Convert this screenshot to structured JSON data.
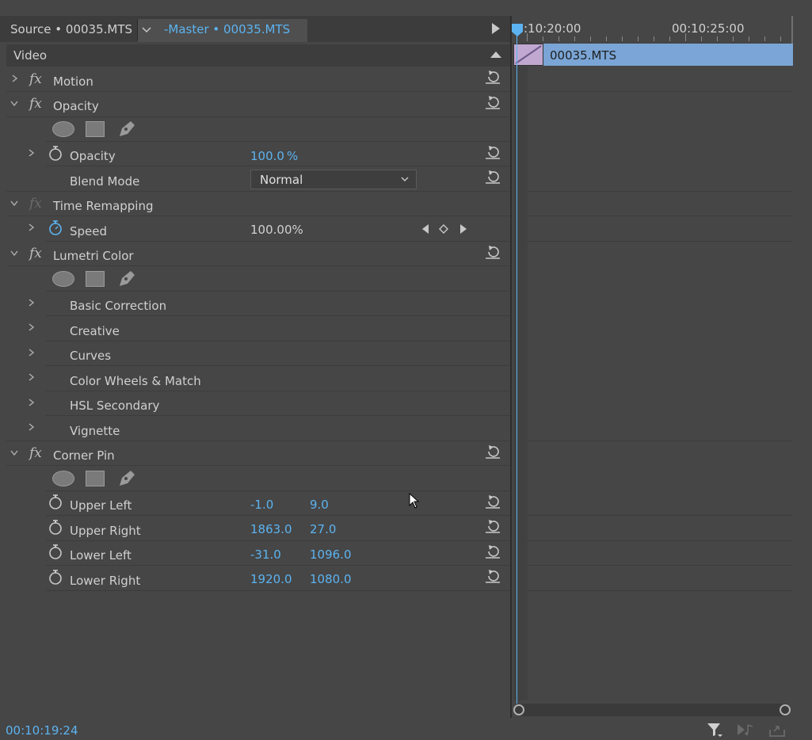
{
  "tabs": {
    "source": "Source • 00035.MTS",
    "master": "-Master  • 00035.MTS"
  },
  "section": {
    "video": "Video"
  },
  "effects": {
    "motion": "Motion",
    "opacity": "Opacity",
    "opacity_prop": "Opacity",
    "opacity_value": "100.0",
    "opacity_unit": "%",
    "blend_mode": "Blend Mode",
    "blend_value": "Normal",
    "time_remapping": "Time Remapping",
    "speed": "Speed",
    "speed_value": "100.00%",
    "lumetri": "Lumetri Color",
    "lumetri_items": [
      "Basic Correction",
      "Creative",
      "Curves",
      "Color Wheels & Match",
      "HSL Secondary",
      "Vignette"
    ],
    "corner_pin": "Corner Pin",
    "corner_rows": [
      {
        "label": "Upper Left",
        "x": "-1.0",
        "y": "9.0"
      },
      {
        "label": "Upper Right",
        "x": "1863.0",
        "y": "27.0"
      },
      {
        "label": "Lower Left",
        "x": "-31.0",
        "y": "1096.0"
      },
      {
        "label": "Lower Right",
        "x": "1920.0",
        "y": "1080.0"
      }
    ]
  },
  "timeline": {
    "ruler_time_1": ":10:20:00",
    "ruler_time_2": "00:10:25:00",
    "clip_name": "00035.MTS"
  },
  "footer": {
    "timecode": "00:10:19:24"
  },
  "colors": {
    "accent": "#5cb3f0",
    "clip": "#7aa5d6",
    "panel": "#464646"
  }
}
